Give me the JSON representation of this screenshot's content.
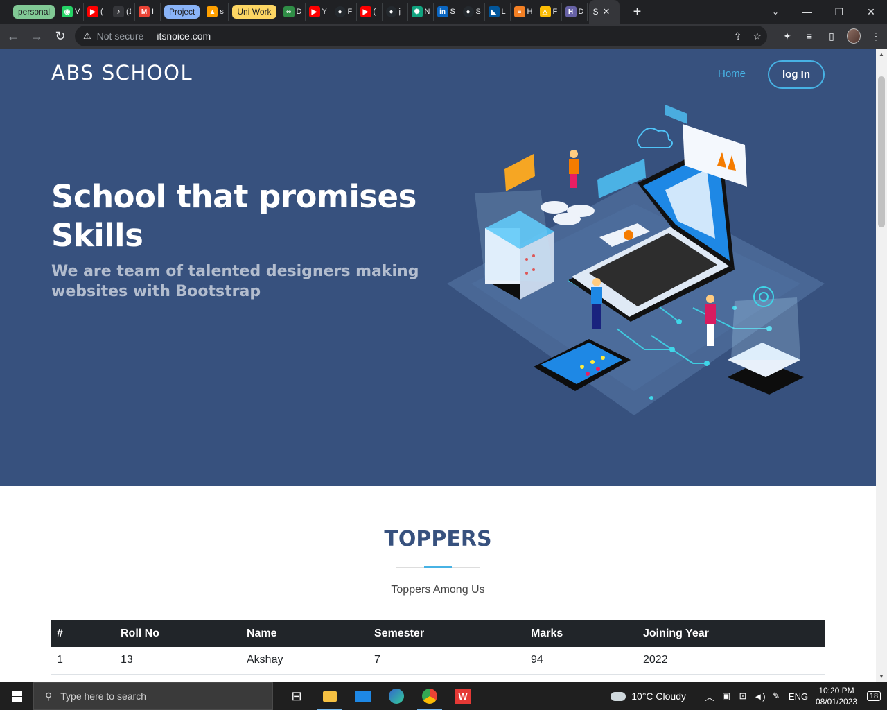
{
  "browser": {
    "tab_groups": {
      "personal": "personal",
      "project": "Project",
      "uni_work": "Uni Work"
    },
    "tabs": [
      {
        "icon": "whatsapp-icon",
        "title": "V",
        "color": "#25d366",
        "glyph": "◉"
      },
      {
        "icon": "youtube-icon",
        "title": "(",
        "color": "#ff0000",
        "glyph": "▶"
      },
      {
        "icon": "audio-icon",
        "title": "(1",
        "color": "#35363a",
        "glyph": "🔈"
      },
      {
        "icon": "gmail-icon",
        "title": "I",
        "color": "#ea4335",
        "glyph": "M"
      },
      {
        "icon": "firebase-icon",
        "title": "s",
        "color": "#ffa000",
        "glyph": "▲"
      },
      {
        "icon": "geeksforgeeks-icon",
        "title": "D",
        "color": "#2f8d46",
        "glyph": "∞"
      },
      {
        "icon": "youtube-icon",
        "title": "Y",
        "color": "#ff0000",
        "glyph": "▶"
      },
      {
        "icon": "github-icon",
        "title": "F",
        "color": "#24292e",
        "glyph": "●"
      },
      {
        "icon": "youtube-icon",
        "title": "(",
        "color": "#ff0000",
        "glyph": "▶"
      },
      {
        "icon": "github-icon",
        "title": "j",
        "color": "#24292e",
        "glyph": "●"
      },
      {
        "icon": "chatgpt-icon",
        "title": "N",
        "color": "#10a37f",
        "glyph": "✺"
      },
      {
        "icon": "linkedin-icon",
        "title": "S",
        "color": "#0a66c2",
        "glyph": "in"
      },
      {
        "icon": "github-icon",
        "title": "S",
        "color": "#24292e",
        "glyph": "●"
      },
      {
        "icon": "flutter-icon",
        "title": "L",
        "color": "#02569b",
        "glyph": "◣"
      },
      {
        "icon": "stackoverflow-icon",
        "title": "H",
        "color": "#f48024",
        "glyph": "≡"
      },
      {
        "icon": "drive-icon",
        "title": "F",
        "color": "#fbbc04",
        "glyph": "△"
      },
      {
        "icon": "heroku-icon",
        "title": "D",
        "color": "#6762a6",
        "glyph": "H"
      }
    ],
    "active_tab": {
      "title": "S",
      "close": "✕"
    },
    "new_tab": "+",
    "window_controls": {
      "tab_search": "⌄",
      "minimize": "—",
      "maximize": "❐",
      "close": "✕"
    },
    "toolbar": {
      "back": "←",
      "forward": "→",
      "reload": "↻",
      "security_icon": "⚠",
      "security_text": "Not secure",
      "url": "itsnoice.com",
      "share": "⇪",
      "bookmark": "☆",
      "extensions": "✦",
      "media": "≡",
      "sidepanel": "▯",
      "menu": "⋮"
    }
  },
  "page": {
    "brand": "ABS SCHOOL",
    "nav": {
      "home": "Home",
      "login": "log In"
    },
    "hero": {
      "title": "School that promises Skills",
      "subtitle": "We are team of talented designers making websites with Bootstrap"
    },
    "toppers": {
      "title": "TOPPERS",
      "subtitle": "Toppers Among Us",
      "columns": [
        "#",
        "Roll No",
        "Name",
        "Semester",
        "Marks",
        "Joining Year"
      ],
      "rows": [
        [
          "1",
          "13",
          "Akshay",
          "7",
          "94",
          "2022"
        ]
      ]
    },
    "colors": {
      "hero_bg": "#37517e",
      "accent": "#47b2e4"
    }
  },
  "taskbar": {
    "search_placeholder": "Type here to search",
    "weather": "10°C  Cloudy",
    "language": "ENG",
    "time": "10:20 PM",
    "date": "08/01/2023",
    "notifications": "18",
    "apps": [
      "task-view-icon",
      "file-explorer-icon",
      "mail-icon",
      "edge-icon",
      "chrome-icon",
      "wps-office-icon"
    ]
  }
}
